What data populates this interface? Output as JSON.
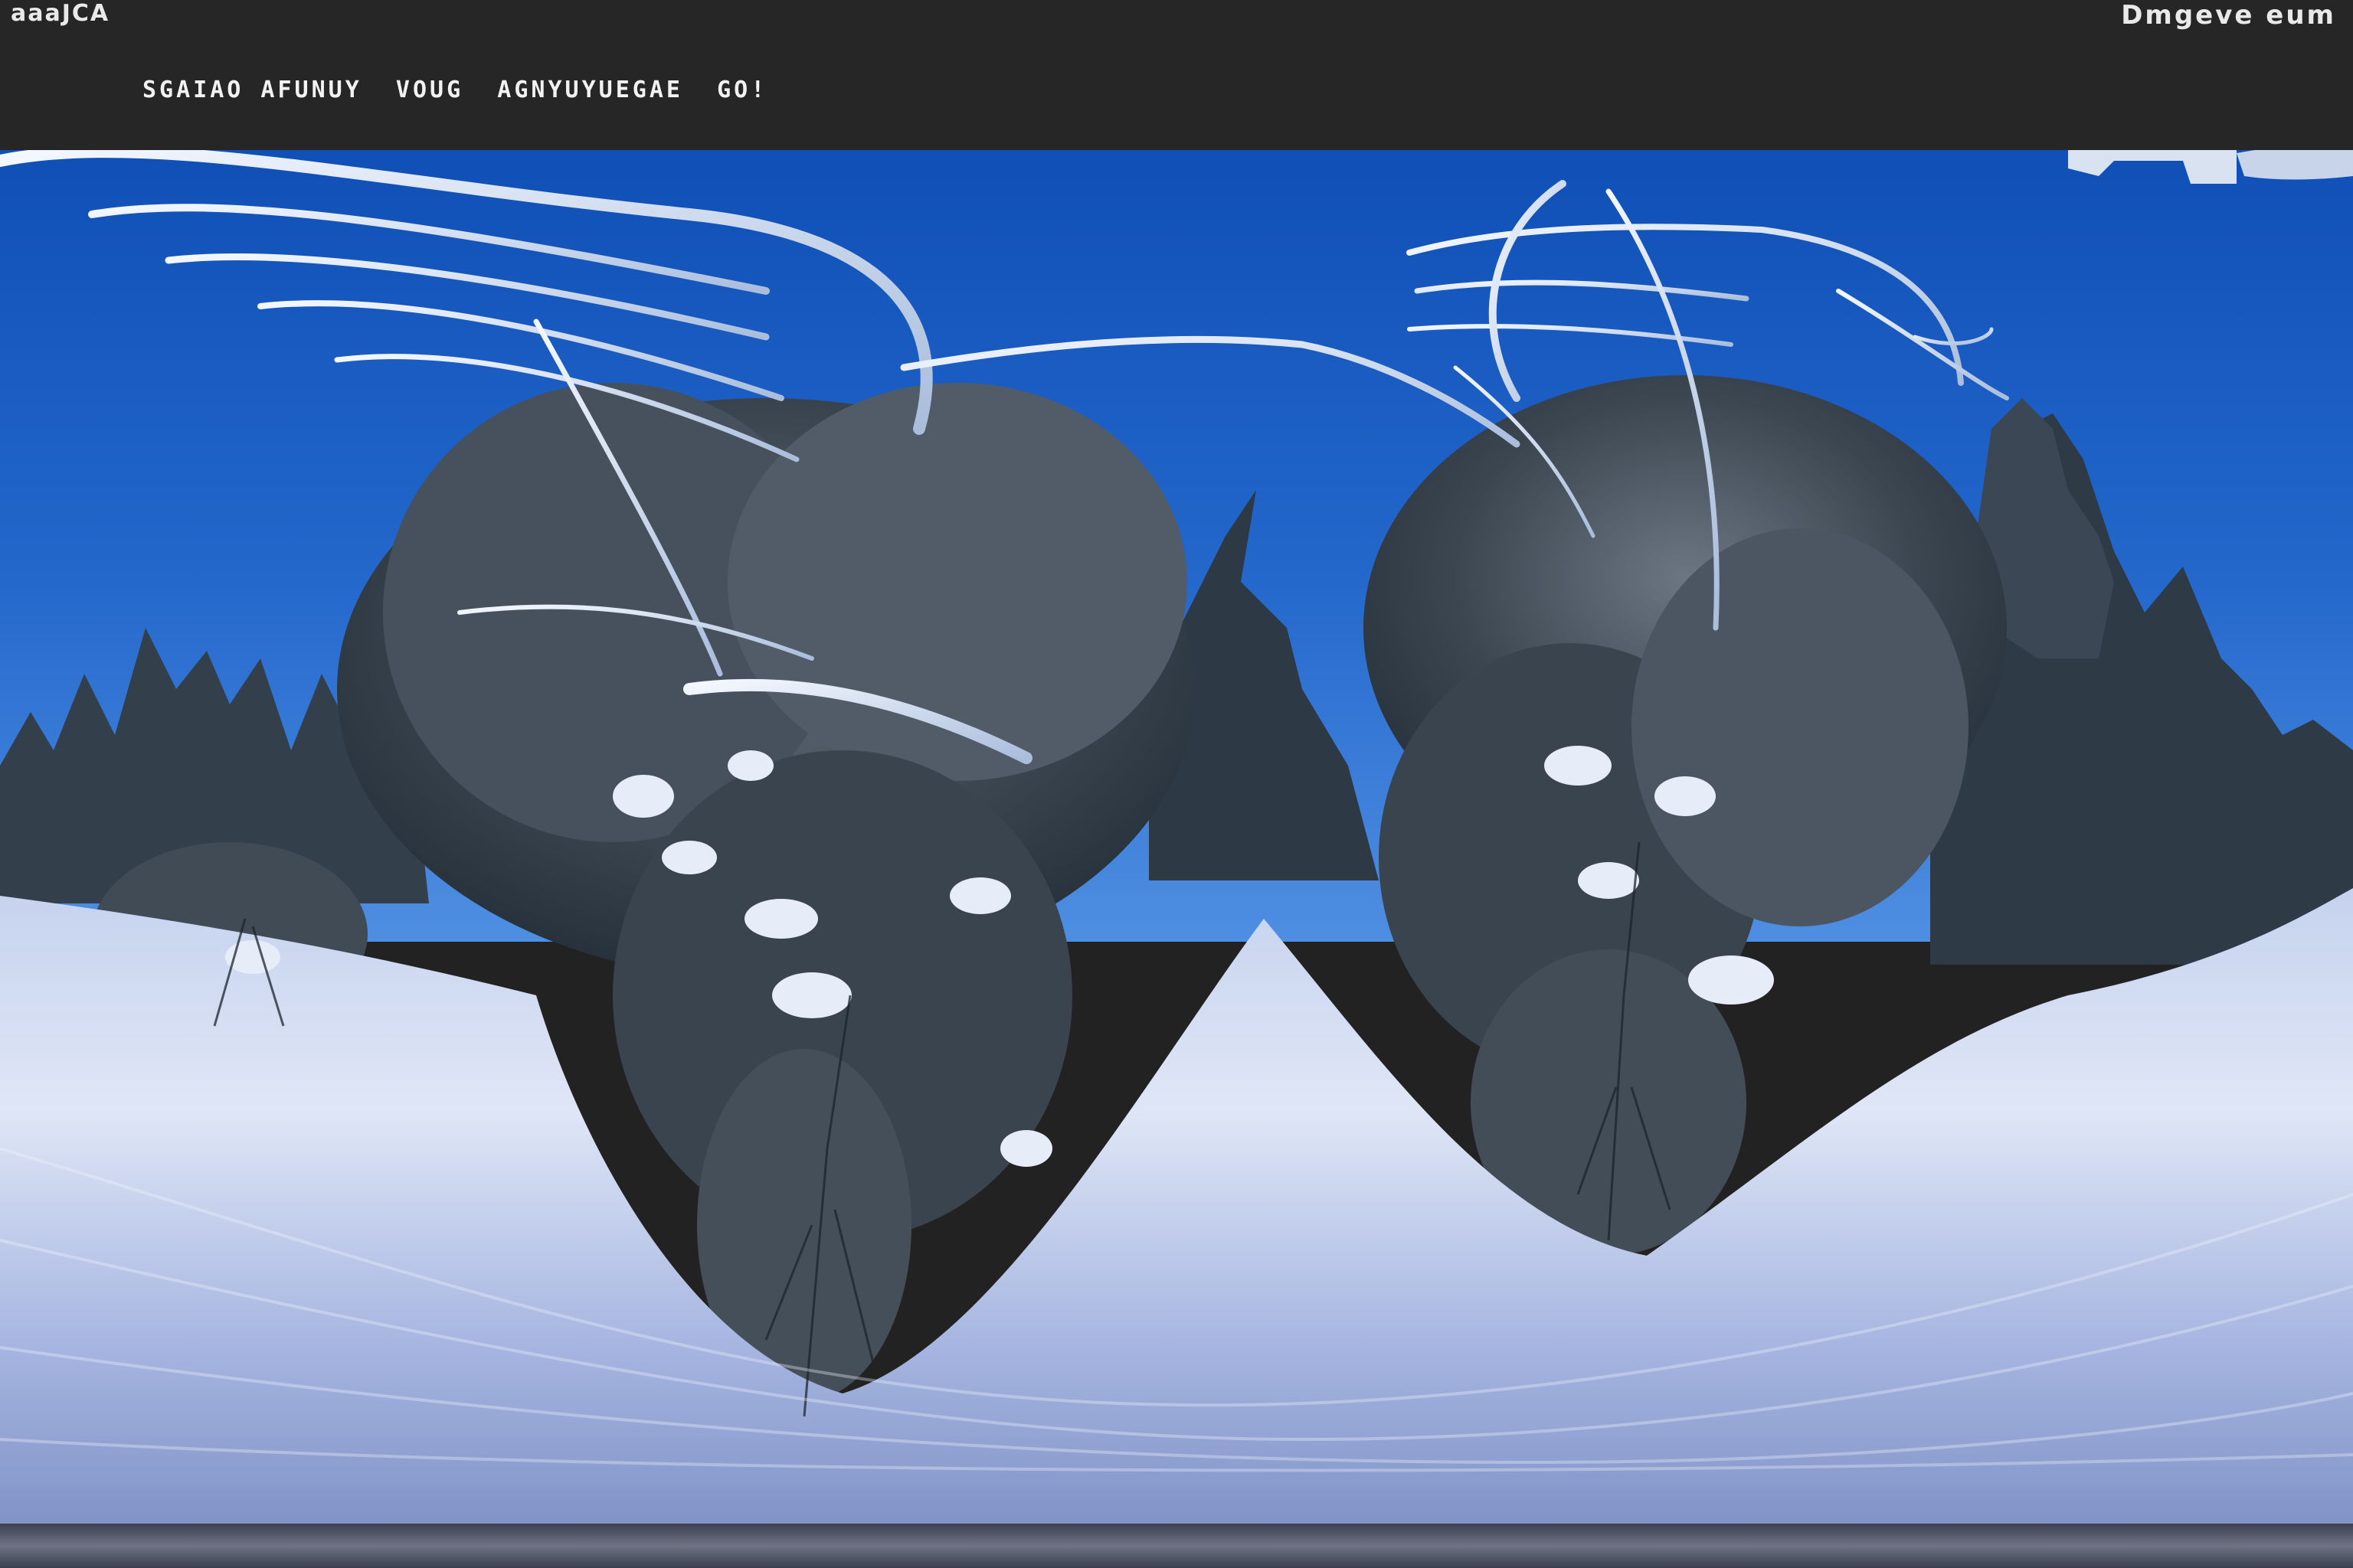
{
  "overlay": {
    "top_left_text": "aaaJCA",
    "top_right_text": "Dmgeve eum",
    "subtitle_text": "SGAIAO AFUNUY  VOUG  AGNYUYUEGAE  GO!"
  },
  "colors": {
    "top_bar": "#262626",
    "sky_top": "#0f4fb6",
    "sky_horizon": "#4f8fe2",
    "snow_light": "#dfe6f6",
    "snow_shadow": "#8d9ed0",
    "tree_dark": "#2d3740",
    "frost": "#e8eef8"
  },
  "scene": {
    "description_kind": "equirectangular winter forest panorama",
    "elements": [
      "sky",
      "frosted-branches-left",
      "frosted-branches-right",
      "evergreen-treeline",
      "snow-covered-ground",
      "ground-streaks",
      "bottom-ice-band"
    ]
  }
}
